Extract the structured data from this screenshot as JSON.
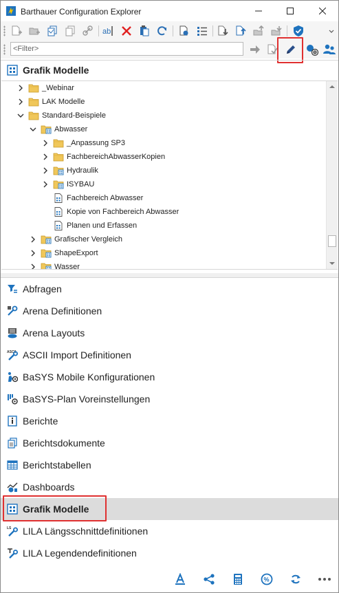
{
  "window": {
    "title": "Barthauer Configuration Explorer",
    "buttons": [
      "minimize",
      "maximize",
      "close"
    ],
    "accent_color": "#1e73be",
    "highlight_color": "#e03030"
  },
  "toolbar": {
    "icons": [
      "new-item-icon",
      "new-folder-icon",
      "copy-icon",
      "copy-move-icon",
      "link-icon",
      "rename-icon",
      "delete-icon",
      "paste-icon",
      "refresh-icon",
      "properties-icon",
      "list-icon",
      "import-icon",
      "export-icon",
      "move-up-icon",
      "move-down-icon",
      "shield-icon",
      "overflow-icon"
    ]
  },
  "filter": {
    "placeholder": "<Filter>"
  },
  "section": {
    "title": "Grafik Modelle"
  },
  "tree": {
    "items": [
      {
        "label": "_Webinar",
        "depth": 0,
        "expanded": false,
        "type": "folder"
      },
      {
        "label": "LAK Modelle",
        "depth": 0,
        "expanded": false,
        "type": "folder"
      },
      {
        "label": "Standard-Beispiele",
        "depth": 0,
        "expanded": true,
        "type": "folder"
      },
      {
        "label": "Abwasser",
        "depth": 1,
        "expanded": true,
        "type": "folder-special"
      },
      {
        "label": "_Anpassung SP3",
        "depth": 2,
        "expanded": false,
        "type": "folder"
      },
      {
        "label": "FachbereichAbwasserKopien",
        "depth": 2,
        "expanded": false,
        "type": "folder"
      },
      {
        "label": "Hydraulik",
        "depth": 2,
        "expanded": false,
        "type": "folder-special"
      },
      {
        "label": "ISYBAU",
        "depth": 2,
        "expanded": false,
        "type": "folder-special"
      },
      {
        "label": "Fachbereich Abwasser",
        "depth": 2,
        "expanded": null,
        "type": "document"
      },
      {
        "label": "Kopie von Fachbereich Abwasser",
        "depth": 2,
        "expanded": null,
        "type": "document"
      },
      {
        "label": "Planen und Erfassen",
        "depth": 2,
        "expanded": null,
        "type": "document"
      },
      {
        "label": "Grafischer Vergleich",
        "depth": 1,
        "expanded": false,
        "type": "folder-special"
      },
      {
        "label": "ShapeExport",
        "depth": 1,
        "expanded": false,
        "type": "folder-special"
      },
      {
        "label": "Wasser",
        "depth": 1,
        "expanded": false,
        "type": "folder-special"
      }
    ]
  },
  "nav": {
    "items": [
      {
        "label": "Abfragen",
        "icon": "query-icon"
      },
      {
        "label": "Arena Definitionen",
        "icon": "arena-definition-icon"
      },
      {
        "label": "Arena Layouts",
        "icon": "arena-layout-icon"
      },
      {
        "label": "ASCII Import Definitionen",
        "icon": "ascii-import-icon"
      },
      {
        "label": "BaSYS Mobile Konfigurationen",
        "icon": "mobile-config-icon"
      },
      {
        "label": "BaSYS-Plan Voreinstellungen",
        "icon": "plan-settings-icon"
      },
      {
        "label": "Berichte",
        "icon": "report-icon"
      },
      {
        "label": "Berichtsdokumente",
        "icon": "report-documents-icon"
      },
      {
        "label": "Berichtstabellen",
        "icon": "report-tables-icon"
      },
      {
        "label": "Dashboards",
        "icon": "dashboard-icon"
      },
      {
        "label": "Grafik Modelle",
        "icon": "graphic-model-icon",
        "active": true
      },
      {
        "label": "LILA Längsschnittdefinitionen",
        "icon": "longitudinal-section-icon"
      },
      {
        "label": "LILA Legendendefinitionen",
        "icon": "legend-definition-icon"
      }
    ]
  },
  "bottombar": {
    "icons": [
      "text-style-icon",
      "share-icon",
      "calculator-icon",
      "percent-icon",
      "sync-icon",
      "more-icon"
    ]
  }
}
